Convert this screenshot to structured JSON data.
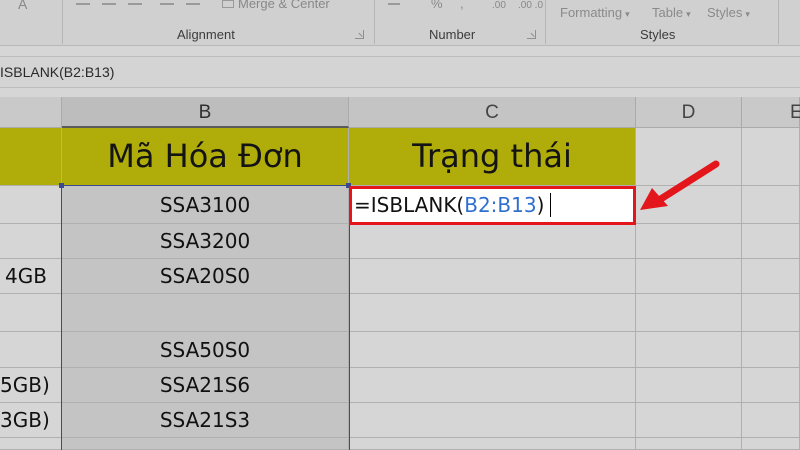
{
  "ribbon": {
    "partial_top_text": "Merge & Center",
    "group_alignment": "Alignment",
    "group_number": "Number",
    "group_styles": "Styles",
    "formatting_btn": "Formatting",
    "table_btn": "Table",
    "styles_btn": "Styles",
    "number_symbols": {
      "pct": "%",
      "comma": ",",
      "inc_dec": ".00",
      "dec_dec": ".00 .0"
    },
    "font_a": "A"
  },
  "formula_bar": {
    "text": "ISBLANK(B2:B13)"
  },
  "columns": [
    {
      "label": "B"
    },
    {
      "label": "C"
    },
    {
      "label": "D"
    },
    {
      "label": "E"
    }
  ],
  "header_row": {
    "b": "Mã Hóa Đơn",
    "c": "Trạng thái"
  },
  "rows": [
    {
      "a": "",
      "b": "SSA3100"
    },
    {
      "a": "",
      "b": "SSA3200"
    },
    {
      "a": "4GB",
      "b": "SSA20S0"
    },
    {
      "a": "",
      "b": ""
    },
    {
      "a": "",
      "b": "SSA50S0"
    },
    {
      "a": "5GB)",
      "b": "SSA21S6"
    },
    {
      "a": "3GB)",
      "b": "SSA21S3"
    }
  ],
  "edit_cell": {
    "prefix": "=ISBLANK(",
    "ref": "B2:B13",
    "suffix": ")"
  },
  "colors": {
    "header_fill": "#b0ad0a",
    "edit_border": "#e3161b",
    "arrow": "#e3161b",
    "ref_blue": "#2f6fd0",
    "selection": "#3a4a8c"
  }
}
